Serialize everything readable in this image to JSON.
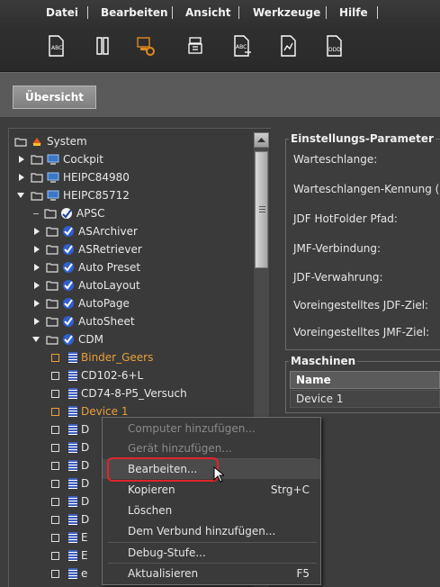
{
  "menubar": {
    "items": [
      "Datei",
      "Bearbeiten",
      "Ansicht",
      "Werkzeuge",
      "Hilfe"
    ]
  },
  "toolbar": {
    "icons": [
      "document-abc-icon",
      "layout-icon",
      "computer-gear-icon",
      "device-icon",
      "abc-arrow-icon",
      "chart-document-icon",
      "ddd-document-icon"
    ],
    "accent": "#e08a1e"
  },
  "tab": {
    "label": "Übersicht"
  },
  "tree": {
    "root": "System",
    "nodes": [
      {
        "label": "Cockpit"
      },
      {
        "label": "HEIPC84980"
      },
      {
        "label": "HEIPC85712"
      },
      {
        "label": "APSC"
      },
      {
        "label": "ASArchiver"
      },
      {
        "label": "ASRetriever"
      },
      {
        "label": "Auto Preset"
      },
      {
        "label": "AutoLayout"
      },
      {
        "label": "AutoPage"
      },
      {
        "label": "AutoSheet"
      },
      {
        "label": "CDM"
      },
      {
        "label": "Binder_Geers"
      },
      {
        "label": "CD102-6+L"
      },
      {
        "label": "CD74-8-P5_Versuch"
      },
      {
        "label": "Device 1"
      },
      {
        "label": "D"
      },
      {
        "label": "D"
      },
      {
        "label": "D"
      },
      {
        "label": "D"
      },
      {
        "label": "D"
      },
      {
        "label": "D"
      },
      {
        "label": "E"
      },
      {
        "label": "E"
      },
      {
        "label": "e"
      }
    ]
  },
  "params": {
    "title": "Einstellungs-Parameter",
    "labels": [
      "Warteschlange:",
      "Warteschlangen-Kennung (De",
      "JDF HotFolder Pfad:",
      "JMF-Verbindung:",
      "JDF-Verwahrung:",
      "Voreingestelltes JDF-Ziel:",
      "Voreingestelltes JMF-Ziel:"
    ]
  },
  "machines": {
    "title": "Maschinen",
    "column": "Name",
    "rows": [
      "Device 1"
    ]
  },
  "context_menu": {
    "items": [
      {
        "label": "Computer hinzufügen...",
        "shortcut": ""
      },
      {
        "label": "Gerät hinzufügen...",
        "shortcut": ""
      },
      {
        "label": "Bearbeiten...",
        "shortcut": ""
      },
      {
        "label": "Kopieren",
        "shortcut": "Strg+C"
      },
      {
        "label": "Löschen",
        "shortcut": ""
      },
      {
        "label": "Dem Verbund hinzufügen...",
        "shortcut": ""
      },
      {
        "label": "Debug-Stufe...",
        "shortcut": ""
      },
      {
        "label": "Aktualisieren",
        "shortcut": "F5"
      }
    ],
    "highlight_color": "#e0252b"
  }
}
